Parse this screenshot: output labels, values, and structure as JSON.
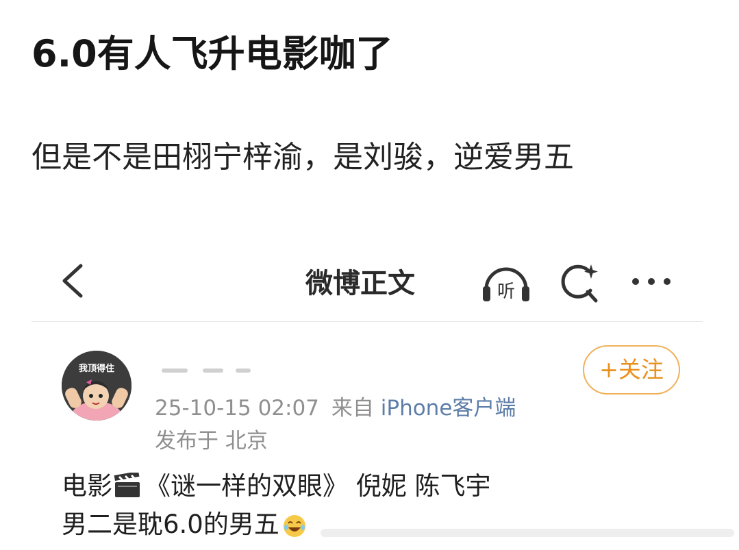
{
  "post": {
    "title": "6.0有人飞升电影咖了",
    "body": "但是不是田栩宁梓渝，是刘骏，逆爱男五"
  },
  "screenshot": {
    "nav": {
      "title": "微博正文",
      "listen_label": "听",
      "icons": [
        "back-icon",
        "listen-icon",
        "search-icon",
        "more-icon"
      ]
    },
    "author": {
      "avatar_text": "我顶得住",
      "timestamp": "25-10-15 02:07",
      "source_label": "来自",
      "device": "iPhone客户端",
      "location": "发布于 北京"
    },
    "follow_button": "+关注",
    "content": {
      "line1_before": "电影",
      "line1_after": "《谜一样的双眼》 倪妮 陈飞宇",
      "line2": "男二是耽6.0的男五"
    },
    "colors": {
      "accent": "#e8901e",
      "follow_border": "#f0b15a",
      "link": "#5c7da8",
      "meta": "#8f8f8f"
    }
  }
}
